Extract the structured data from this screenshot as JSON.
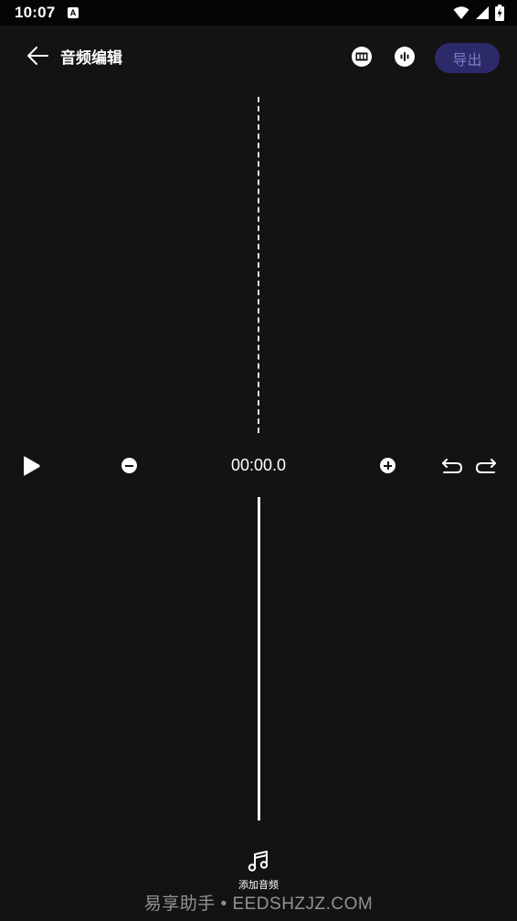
{
  "status_bar": {
    "time": "10:07",
    "app_icon_letter": "A"
  },
  "header": {
    "title": "音频编辑",
    "export_label": "导出"
  },
  "controls": {
    "time": "00:00.0"
  },
  "footer": {
    "add_audio_label": "添加音频",
    "watermark": "易享助手 • EEDSHZJZ.COM"
  },
  "icons": {
    "back": "back-arrow-icon",
    "tool_1": "film-strip-icon",
    "tool_2": "audio-wave-icon",
    "play": "play-icon",
    "zoom_out": "minus-circle-icon",
    "zoom_in": "plus-circle-icon",
    "undo": "undo-icon",
    "redo": "redo-icon",
    "add_audio": "music-note-icon"
  },
  "colors": {
    "background": "#131313",
    "export_bg": "#2d2a6a",
    "export_text": "#7c79c8"
  }
}
